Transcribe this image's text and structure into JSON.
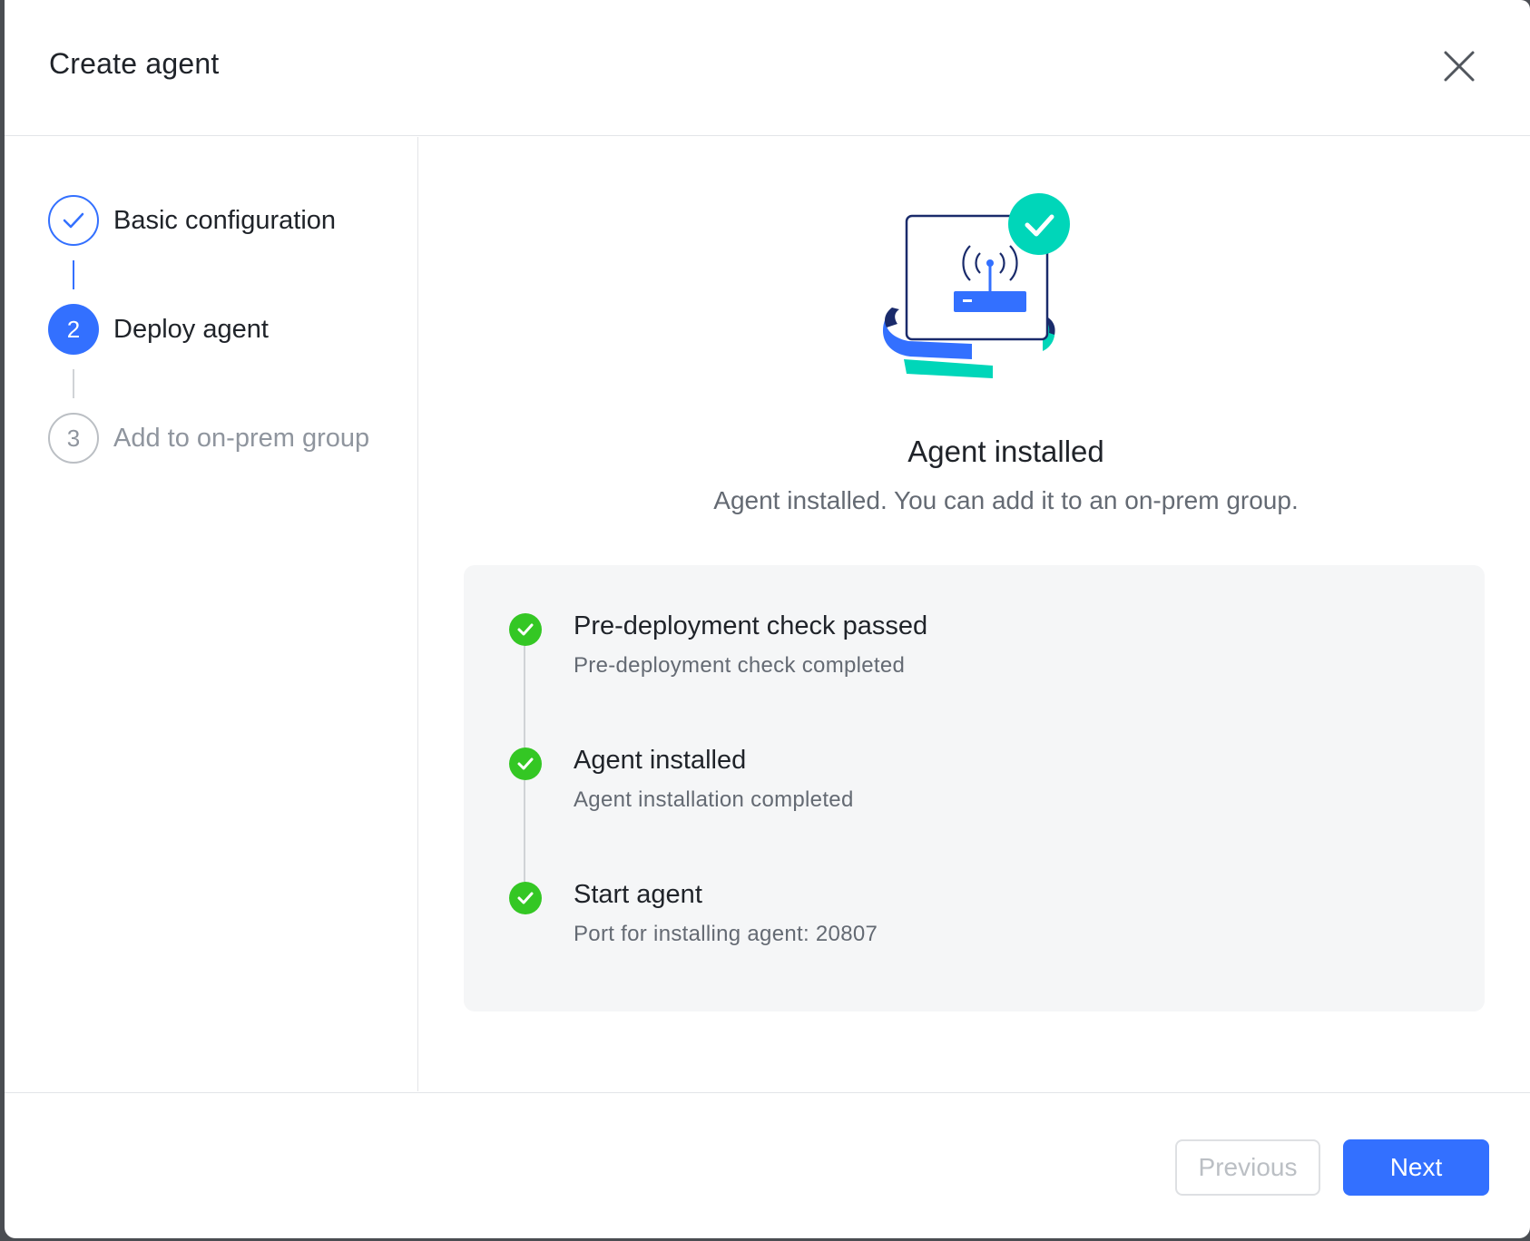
{
  "dialog": {
    "title": "Create agent"
  },
  "steps": [
    {
      "number": "1",
      "label": "Basic configuration",
      "status": "completed"
    },
    {
      "number": "2",
      "label": "Deploy agent",
      "status": "active"
    },
    {
      "number": "3",
      "label": "Add to on-prem group",
      "status": "pending"
    }
  ],
  "result": {
    "title": "Agent installed",
    "description": "Agent installed. You can add it to an on-prem group."
  },
  "timeline": [
    {
      "title": "Pre-deployment check passed",
      "subtitle": "Pre-deployment check completed",
      "status": "success"
    },
    {
      "title": "Agent installed",
      "subtitle": "Agent installation completed",
      "status": "success"
    },
    {
      "title": "Start agent",
      "subtitle": "Port for installing agent: 20807",
      "status": "success"
    }
  ],
  "footer": {
    "previous_label": "Previous",
    "next_label": "Next"
  },
  "colors": {
    "primary": "#3370ff",
    "success": "#34c724",
    "accent_teal": "#00d6b9",
    "navy": "#1a2b6b"
  },
  "icons": {
    "close": "close-icon",
    "step_done": "check-icon",
    "timeline": "success-check-icon",
    "illustration": "router-icon"
  }
}
